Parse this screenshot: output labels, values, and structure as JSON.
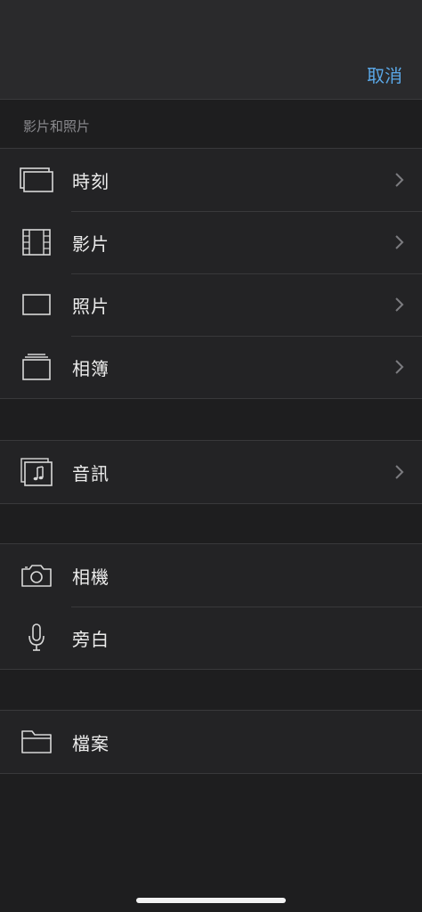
{
  "header": {
    "cancel_label": "取消"
  },
  "section_media": {
    "title": "影片和照片",
    "items": [
      {
        "label": "時刻",
        "icon": "moments-icon"
      },
      {
        "label": "影片",
        "icon": "film-icon"
      },
      {
        "label": "照片",
        "icon": "photo-icon"
      },
      {
        "label": "相簿",
        "icon": "albums-icon"
      }
    ]
  },
  "section_audio": {
    "items": [
      {
        "label": "音訊",
        "icon": "music-note-icon"
      }
    ]
  },
  "section_capture": {
    "items": [
      {
        "label": "相機",
        "icon": "camera-icon"
      },
      {
        "label": "旁白",
        "icon": "microphone-icon"
      }
    ]
  },
  "section_files": {
    "items": [
      {
        "label": "檔案",
        "icon": "folder-icon"
      }
    ]
  },
  "colors": {
    "accent": "#5aa7e6",
    "background": "#1e1e1f",
    "row_background": "#232325",
    "separator": "#39393b"
  }
}
